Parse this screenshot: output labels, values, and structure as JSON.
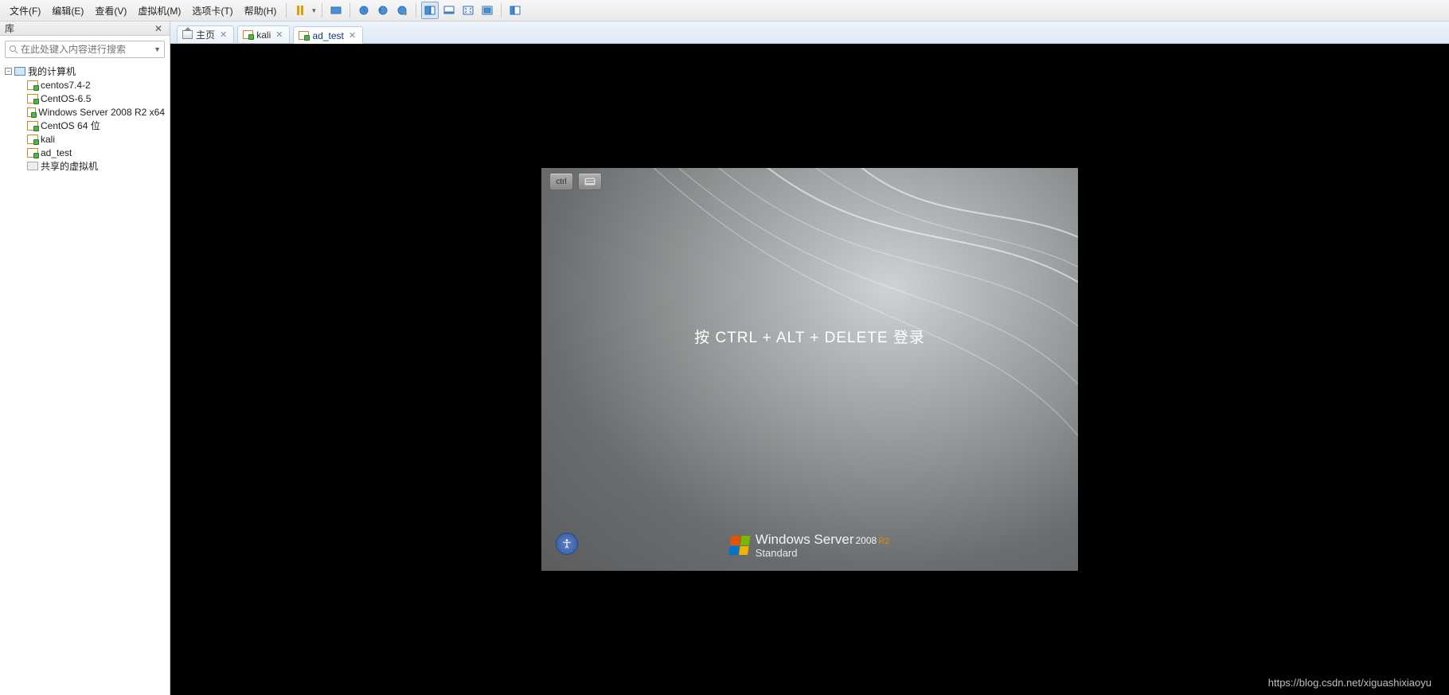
{
  "menu": {
    "file": "文件(F)",
    "edit": "编辑(E)",
    "view": "查看(V)",
    "vm": "虚拟机(M)",
    "tabs": "选项卡(T)",
    "help": "帮助(H)"
  },
  "toolbar_icons": {
    "pause": "pause-icon",
    "snapshot_take": "camera-icon",
    "snapshot_revert": "clock-back-icon",
    "snapshot_manage": "clock-gear-icon",
    "snapshot": "snapshot-icon",
    "unity": "unity-icon",
    "console": "console-icon",
    "stretch": "stretch-icon",
    "fullscreen": "fullscreen-icon",
    "library": "library-icon"
  },
  "sidebar": {
    "title": "库",
    "search_placeholder": "在此处键入内容进行搜索",
    "root": "我的计算机",
    "vms": [
      {
        "name": "centos7.4-2",
        "state": "running"
      },
      {
        "name": "CentOS-6.5",
        "state": "running"
      },
      {
        "name": "Windows Server 2008 R2 x64",
        "state": "running"
      },
      {
        "name": "CentOS 64 位",
        "state": "running"
      },
      {
        "name": "kali",
        "state": "running"
      },
      {
        "name": "ad_test",
        "state": "running"
      }
    ],
    "shared": "共享的虚拟机"
  },
  "tabs": [
    {
      "label": "主页",
      "kind": "home",
      "active": false
    },
    {
      "label": "kali",
      "kind": "vm",
      "active": false
    },
    {
      "label": "ad_test",
      "kind": "vm",
      "active": true
    }
  ],
  "guest": {
    "ctrl_label": "ctrl",
    "login_message": "按 CTRL + ALT + DELETE 登录",
    "brand_main": "Windows Server",
    "brand_year": "2008",
    "brand_r2": "R2",
    "brand_edition": "Standard"
  },
  "watermark": "https://blog.csdn.net/xiguashixiaoyu"
}
